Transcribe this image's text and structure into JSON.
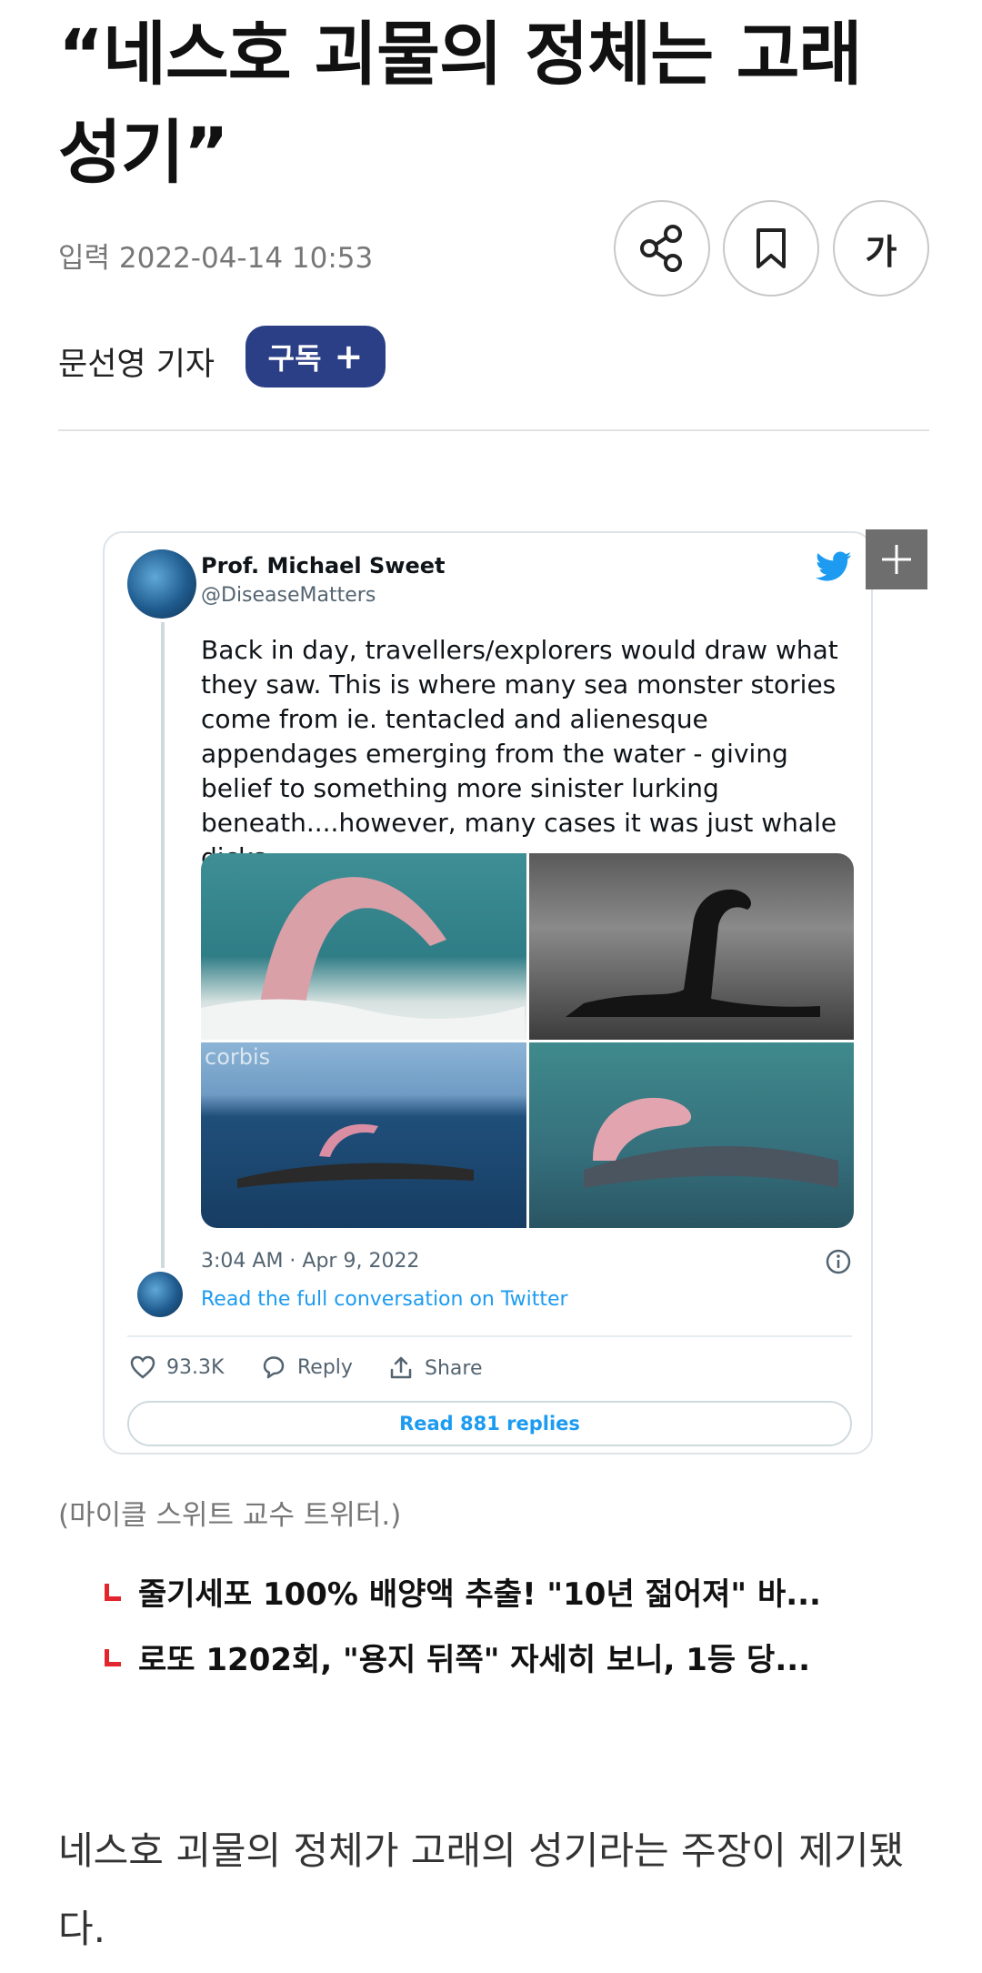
{
  "article": {
    "headline": "“네스호 괴물의 정체는 고래 성기”",
    "date": "입력 2022-04-14 10:53",
    "reporter": "문선영 기자",
    "subscribe_label": "구독",
    "font_button_label": "가",
    "caption": "(마이클 스위트 교수 트위터.)",
    "body": "네스호 괴물의 정체가 고래의 성기라는 주장이 제기됐다."
  },
  "tweet": {
    "author_name": "Prof. Michael Sweet",
    "author_handle": "@DiseaseMatters",
    "text": "Back in day, travellers/explorers would draw what they saw. This is where many sea monster stories come from ie. tentacled and alienesque appendages emerging from the water - giving belief to something more sinister lurking beneath....however, many cases it was just whale dicks.",
    "photo_watermark": "corbis",
    "timestamp": "3:04 AM · Apr 9, 2022",
    "read_conversation": "Read the full conversation on Twitter",
    "likes": "93.3K",
    "reply_label": "Reply",
    "share_label": "Share",
    "read_replies": "Read 881 replies"
  },
  "related": [
    "줄기세포 100% 배양액 추출! \"10년 젊어져\" 바...",
    "로또 1202회, \"용지 뒤쪽\" 자세히 보니, 1등 당..."
  ],
  "icons": {
    "share": "share-icon",
    "bookmark": "bookmark-icon",
    "twitter": "twitter-bird-icon",
    "expand": "plus-icon",
    "info": "info-icon",
    "like": "heart-icon",
    "reply": "speech-bubble-icon",
    "tweet_share": "upload-icon"
  },
  "colors": {
    "subscribe_bg": "#2b3f86",
    "twitter_blue": "#1d9bf0",
    "bullet_red": "#e3262d"
  }
}
